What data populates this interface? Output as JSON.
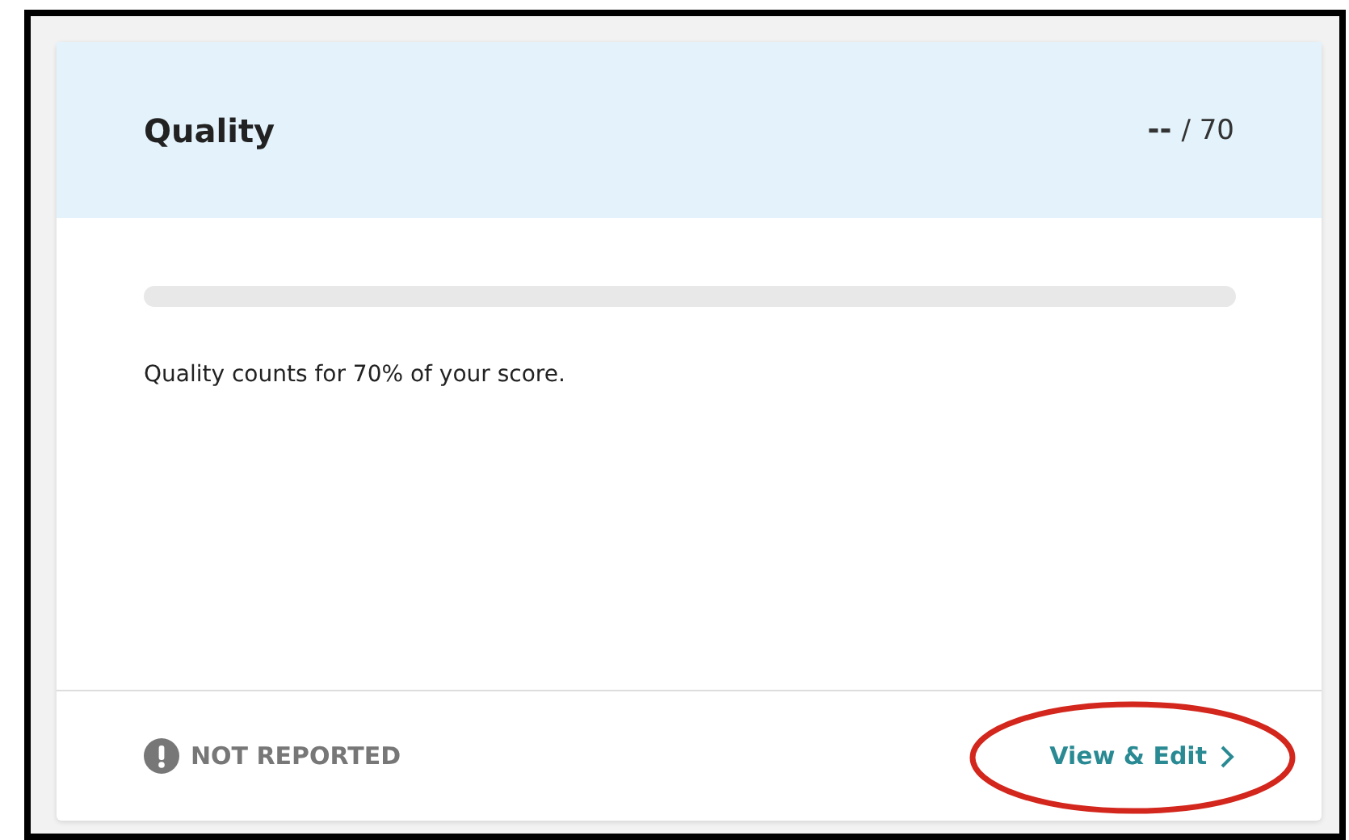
{
  "card": {
    "title": "Quality",
    "score": "--",
    "score_max": "/ 70",
    "progress": {
      "level": 0
    },
    "description": "Quality counts for 70% of your score.",
    "status": "NOT REPORTED",
    "action": "View & Edit",
    "action_highlighted": true
  }
}
